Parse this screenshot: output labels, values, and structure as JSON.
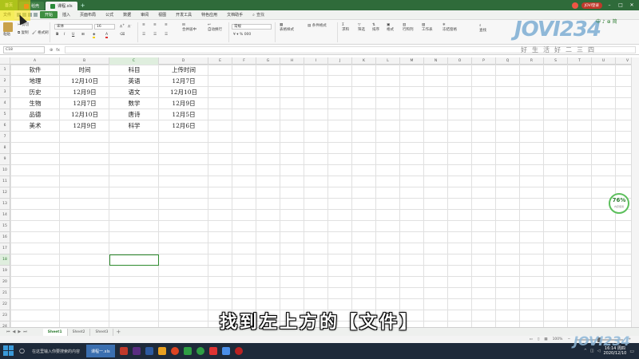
{
  "window": {
    "app_button": "首页",
    "tabs": [
      {
        "label": "稻壳"
      },
      {
        "label": "课程.xls"
      }
    ],
    "user_badge": "JOVI登录"
  },
  "menubar": {
    "file": "文件",
    "items": [
      "开始",
      "插入",
      "页面布局",
      "公式",
      "数据",
      "审阅",
      "视图",
      "开发工具",
      "特色应用",
      "文档助手"
    ],
    "active": "开始",
    "search": "查找"
  },
  "ribbon": {
    "paste": "粘贴",
    "cut": "剪切",
    "copy": "复制",
    "format_painter": "格式刷",
    "font_name": "宋体",
    "font_size": "16",
    "number_format": "常规",
    "merge_center": "合并居中",
    "auto_wrap": "自动换行",
    "conditional_format": "条件格式",
    "table_style": "表格样式",
    "sum": "求和",
    "filter": "筛选",
    "sort": "排序",
    "format": "格式",
    "row_col": "行和列",
    "worksheet": "工作表",
    "freeze": "冻结窗格",
    "find": "查找"
  },
  "formula_bar": {
    "name_box": "C18",
    "fx": "fx",
    "value": ""
  },
  "sheet": {
    "columns": [
      "A",
      "B",
      "C",
      "D",
      "E",
      "F",
      "G",
      "H",
      "I",
      "J",
      "K",
      "L",
      "M",
      "N",
      "O",
      "P",
      "Q",
      "R",
      "S",
      "T",
      "U",
      "V",
      "W"
    ],
    "rows": [
      "1",
      "2",
      "3",
      "4",
      "5",
      "6",
      "7",
      "8",
      "9",
      "10",
      "11",
      "12",
      "13",
      "14",
      "15",
      "16",
      "17",
      "18",
      "19",
      "20",
      "21",
      "22",
      "23",
      "24"
    ],
    "table": [
      [
        "软件",
        "时间",
        "科目",
        "上传时间"
      ],
      [
        "地理",
        "12月10日",
        "英语",
        "12月7日"
      ],
      [
        "历史",
        "12月9日",
        "语文",
        "12月10日"
      ],
      [
        "生物",
        "12月7日",
        "数学",
        "12月9日"
      ],
      [
        "品德",
        "12月10日",
        "唐诗",
        "12月5日"
      ],
      [
        "美术",
        "12月9日",
        "科学",
        "12月6日"
      ]
    ]
  },
  "sheet_tabs": [
    "Sheet1",
    "Sheet2",
    "Sheet3"
  ],
  "statusbar": {
    "zoom": "100%"
  },
  "taskbar": {
    "search_text": "在这里输入你要搜索的内容",
    "active_task": "课程一.xls",
    "time": "16:14 周四",
    "date": "2020/12/10"
  },
  "overlay": {
    "subtitle": "找到左上方的【文件】",
    "logo": "JOVI234",
    "logo_sub": "好生活好二三四",
    "logo_mini": "中 ♪ ⊕ 简",
    "gauge_value": "76%",
    "gauge_sub": "内存使用"
  },
  "colors": {
    "accent": "#3e8e41",
    "title_bar": "#2f6b3a",
    "active_cell_border": "#2e8b2e"
  }
}
